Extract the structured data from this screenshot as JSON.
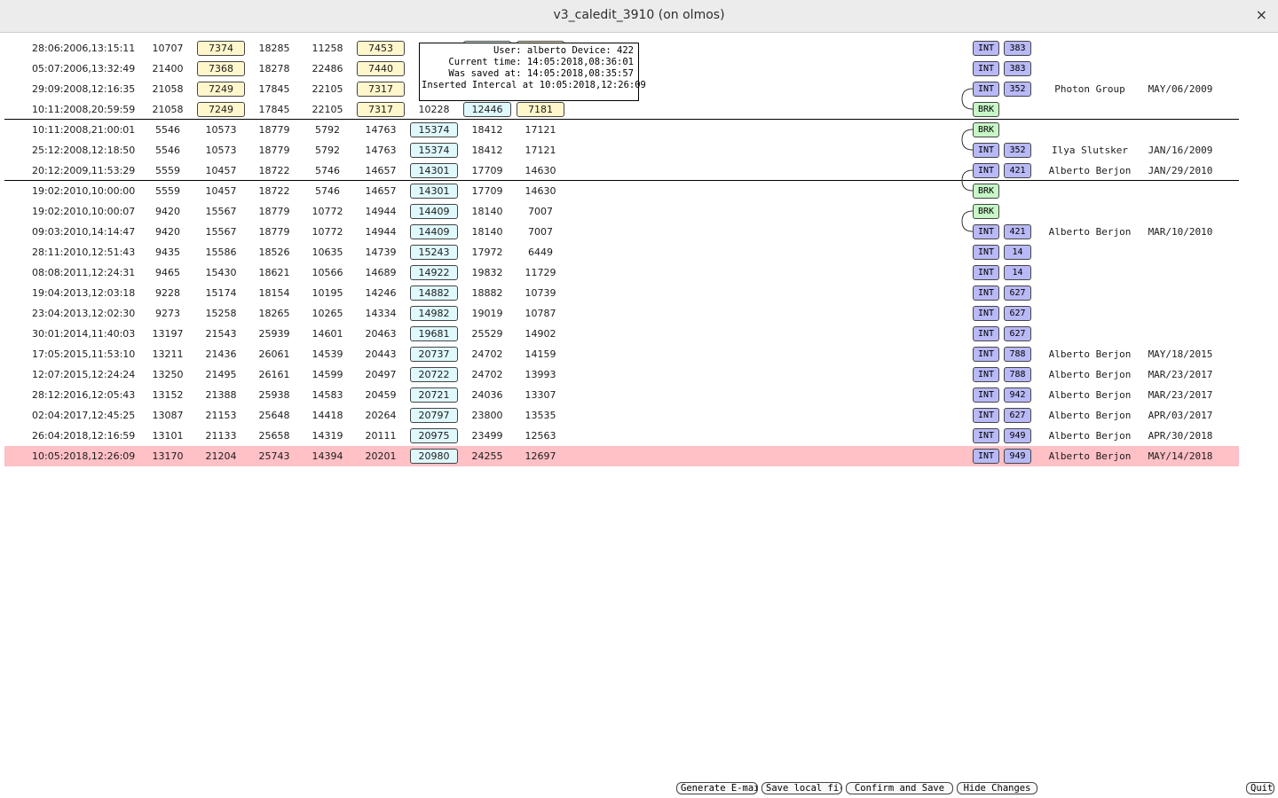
{
  "window": {
    "title": "v3_caledit_3910 (on olmos)",
    "close_symbol": "×"
  },
  "tooltip": [
    "User: alberto Device: 422",
    "Current time: 14:05:2018,08:36:01",
    "Was saved at: 14:05:2018,08:35:57",
    "Inserted Intercal at 10:05:2018,12:26:09"
  ],
  "rows": [
    {
      "date": "28:06:2006,13:15:11",
      "c": [
        "10707",
        "7374",
        "18285",
        "11258",
        "7453",
        "",
        "",
        ""
      ],
      "type": "INT",
      "num": "383",
      "user": "",
      "saved": ""
    },
    {
      "date": "05:07:2006,13:32:49",
      "c": [
        "21400",
        "7368",
        "18278",
        "22486",
        "7440",
        "",
        "",
        ""
      ],
      "type": "INT",
      "num": "383",
      "user": "",
      "saved": ""
    },
    {
      "date": "29:09:2008,12:16:35",
      "c": [
        "21058",
        "7249",
        "17845",
        "22105",
        "7317",
        "",
        "",
        ""
      ],
      "type": "INT",
      "num": "352",
      "user": "Photon Group",
      "saved": "MAY/06/2009"
    },
    {
      "date": "10:11:2008,20:59:59",
      "c": [
        "21058",
        "7249",
        "17845",
        "22105",
        "7317",
        "10228",
        "12446",
        "7181"
      ],
      "type": "BRK",
      "num": "",
      "user": "",
      "saved": ""
    },
    {
      "date": "10:11:2008,21:00:01",
      "c": [
        "5546",
        "10573",
        "18779",
        "5792",
        "14763",
        "15374",
        "18412",
        "17121"
      ],
      "type": "BRK",
      "num": "",
      "user": "",
      "saved": ""
    },
    {
      "date": "25:12:2008,12:18:50",
      "c": [
        "5546",
        "10573",
        "18779",
        "5792",
        "14763",
        "15374",
        "18412",
        "17121"
      ],
      "type": "INT",
      "num": "352",
      "user": "Ilya Slutsker",
      "saved": "JAN/16/2009"
    },
    {
      "date": "20:12:2009,11:53:29",
      "c": [
        "5559",
        "10457",
        "18722",
        "5746",
        "14657",
        "14301",
        "17709",
        "14630"
      ],
      "type": "INT",
      "num": "421",
      "user": "Alberto Berjon",
      "saved": "JAN/29/2010"
    },
    {
      "date": "19:02:2010,10:00:00",
      "c": [
        "5559",
        "10457",
        "18722",
        "5746",
        "14657",
        "14301",
        "17709",
        "14630"
      ],
      "type": "BRK",
      "num": "",
      "user": "",
      "saved": ""
    },
    {
      "date": "19:02:2010,10:00:07",
      "c": [
        "9420",
        "15567",
        "18779",
        "10772",
        "14944",
        "14409",
        "18140",
        "7007"
      ],
      "type": "BRK",
      "num": "",
      "user": "",
      "saved": ""
    },
    {
      "date": "09:03:2010,14:14:47",
      "c": [
        "9420",
        "15567",
        "18779",
        "10772",
        "14944",
        "14409",
        "18140",
        "7007"
      ],
      "type": "INT",
      "num": "421",
      "user": "Alberto Berjon",
      "saved": "MAR/10/2010"
    },
    {
      "date": "28:11:2010,12:51:43",
      "c": [
        "9435",
        "15586",
        "18526",
        "10635",
        "14739",
        "15243",
        "17972",
        "6449"
      ],
      "type": "INT",
      "num": "14",
      "user": "",
      "saved": ""
    },
    {
      "date": "08:08:2011,12:24:31",
      "c": [
        "9465",
        "15430",
        "18621",
        "10566",
        "14689",
        "14922",
        "19832",
        "11729"
      ],
      "type": "INT",
      "num": "14",
      "user": "",
      "saved": ""
    },
    {
      "date": "19:04:2013,12:03:18",
      "c": [
        "9228",
        "15174",
        "18154",
        "10195",
        "14246",
        "14882",
        "18882",
        "10739"
      ],
      "type": "INT",
      "num": "627",
      "user": "",
      "saved": ""
    },
    {
      "date": "23:04:2013,12:02:30",
      "c": [
        "9273",
        "15258",
        "18265",
        "10265",
        "14334",
        "14982",
        "19019",
        "10787"
      ],
      "type": "INT",
      "num": "627",
      "user": "",
      "saved": ""
    },
    {
      "date": "30:01:2014,11:40:03",
      "c": [
        "13197",
        "21543",
        "25939",
        "14601",
        "20463",
        "19681",
        "25529",
        "14902"
      ],
      "type": "INT",
      "num": "627",
      "user": "",
      "saved": ""
    },
    {
      "date": "17:05:2015,11:53:10",
      "c": [
        "13211",
        "21436",
        "26061",
        "14539",
        "20443",
        "20737",
        "24702",
        "14159"
      ],
      "type": "INT",
      "num": "788",
      "user": "Alberto Berjon",
      "saved": "MAY/18/2015"
    },
    {
      "date": "12:07:2015,12:24:24",
      "c": [
        "13250",
        "21495",
        "26161",
        "14599",
        "20497",
        "20722",
        "24702",
        "13993"
      ],
      "type": "INT",
      "num": "788",
      "user": "Alberto Berjon",
      "saved": "MAR/23/2017"
    },
    {
      "date": "28:12:2016,12:05:43",
      "c": [
        "13152",
        "21388",
        "25938",
        "14583",
        "20459",
        "20721",
        "24036",
        "13307"
      ],
      "type": "INT",
      "num": "942",
      "user": "Alberto Berjon",
      "saved": "MAR/23/2017"
    },
    {
      "date": "02:04:2017,12:45:25",
      "c": [
        "13087",
        "21153",
        "25648",
        "14418",
        "20264",
        "20797",
        "23800",
        "13535"
      ],
      "type": "INT",
      "num": "627",
      "user": "Alberto Berjon",
      "saved": "APR/03/2017"
    },
    {
      "date": "26:04:2018,12:16:59",
      "c": [
        "13101",
        "21133",
        "25658",
        "14319",
        "20111",
        "20975",
        "23499",
        "12563"
      ],
      "type": "INT",
      "num": "949",
      "user": "Alberto Berjon",
      "saved": "APR/30/2018"
    },
    {
      "date": "10:05:2018,12:26:09",
      "c": [
        "13170",
        "21204",
        "25743",
        "14394",
        "20201",
        "20980",
        "24255",
        "12697"
      ],
      "type": "INT",
      "num": "949",
      "user": "Alberto Berjon",
      "saved": "MAY/14/2018",
      "selected": true
    }
  ],
  "buttons": {
    "generate_email": "Generate E-mail",
    "save_local": "Save local file",
    "confirm_save": "Confirm and Save",
    "hide_changes": "Hide Changes",
    "quit": "Quit"
  }
}
